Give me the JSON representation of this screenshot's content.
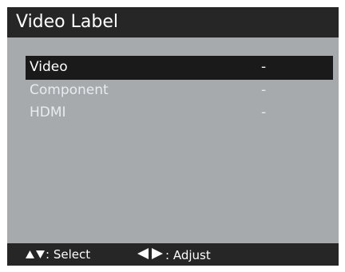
{
  "header": {
    "title": "Video Label"
  },
  "menu": {
    "items": [
      {
        "label": "Video",
        "value": "-",
        "selected": true
      },
      {
        "label": "Component",
        "value": "-",
        "selected": false
      },
      {
        "label": "HDMI",
        "value": "-",
        "selected": false
      }
    ]
  },
  "footer": {
    "select_label": ": Select",
    "adjust_label": ": Adjust",
    "select_icon": "up-down-arrows-icon",
    "adjust_icon": "left-right-arrows-icon"
  },
  "colors": {
    "background": "#a6aaad",
    "bars": "#262626",
    "highlight": "#1a1a1a",
    "text": "#ffffff"
  }
}
